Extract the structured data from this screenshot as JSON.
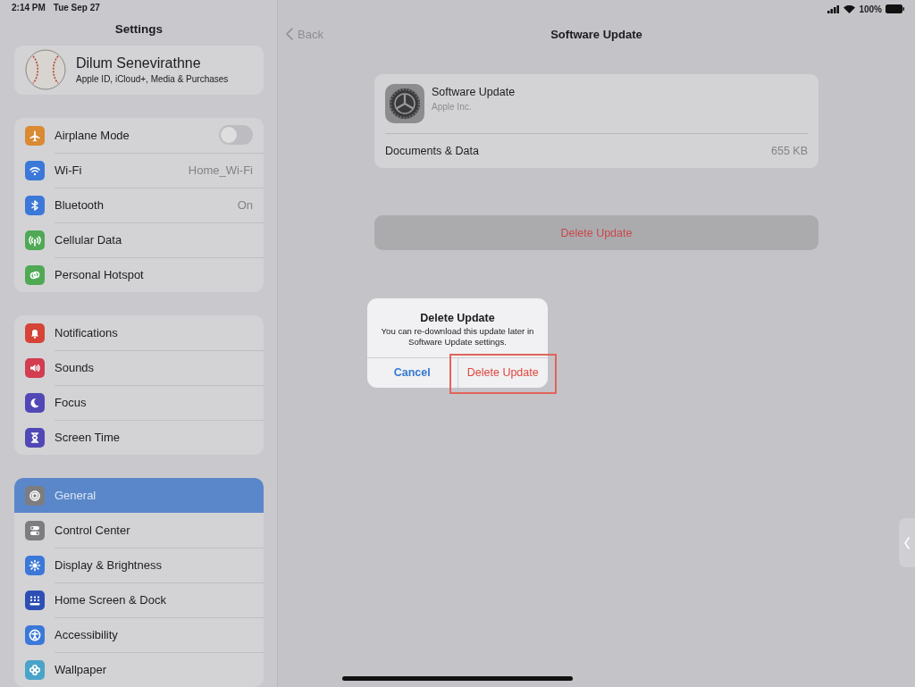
{
  "status_bar": {
    "time": "2:14 PM",
    "date": "Tue Sep 27",
    "battery": "100%"
  },
  "sidebar": {
    "title": "Settings",
    "profile": {
      "name": "Dilum Senevirathne",
      "subtitle": "Apple ID, iCloud+, Media & Purchases"
    },
    "groups": [
      {
        "items": [
          {
            "label": "Airplane Mode",
            "color": "#d98a33",
            "kind": "toggle",
            "on": false,
            "selected": false
          },
          {
            "label": "Wi-Fi",
            "color": "#3b78d8",
            "kind": "value",
            "value": "Home_Wi-Fi",
            "selected": false
          },
          {
            "label": "Bluetooth",
            "color": "#3b78d8",
            "kind": "value",
            "value": "On",
            "selected": false
          },
          {
            "label": "Cellular Data",
            "color": "#4fa955",
            "kind": "plain",
            "selected": false
          },
          {
            "label": "Personal Hotspot",
            "color": "#4fa955",
            "kind": "plain",
            "selected": false
          }
        ]
      },
      {
        "items": [
          {
            "label": "Notifications",
            "color": "#d54436",
            "kind": "plain",
            "selected": false
          },
          {
            "label": "Sounds",
            "color": "#d23d4f",
            "kind": "plain",
            "selected": false
          },
          {
            "label": "Focus",
            "color": "#5248b5",
            "kind": "plain",
            "selected": false
          },
          {
            "label": "Screen Time",
            "color": "#5248b5",
            "kind": "plain",
            "selected": false
          }
        ]
      },
      {
        "items": [
          {
            "label": "General",
            "color": "#7d7d80",
            "kind": "plain",
            "selected": true
          },
          {
            "label": "Control Center",
            "color": "#7d7d80",
            "kind": "plain",
            "selected": false
          },
          {
            "label": "Display & Brightness",
            "color": "#3b78d8",
            "kind": "plain",
            "selected": false
          },
          {
            "label": "Home Screen & Dock",
            "color": "#2d4fb5",
            "kind": "plain",
            "selected": false
          },
          {
            "label": "Accessibility",
            "color": "#3b78d8",
            "kind": "plain",
            "selected": false
          },
          {
            "label": "Wallpaper",
            "color": "#4aa3c9",
            "kind": "plain",
            "selected": false
          }
        ]
      }
    ]
  },
  "detail": {
    "back": "Back",
    "title": "Software Update",
    "app": {
      "name": "Software Update",
      "developer": "Apple Inc.",
      "row_label": "Documents & Data",
      "row_value": "655 KB"
    },
    "delete_button": "Delete Update"
  },
  "alert": {
    "title": "Delete Update",
    "message": "You can re-download this update later in Software Update settings.",
    "buttons": [
      {
        "label": "Cancel",
        "kind": "cancel",
        "highlighted": false
      },
      {
        "label": "Delete Update",
        "kind": "destructive",
        "highlighted": true
      }
    ]
  }
}
